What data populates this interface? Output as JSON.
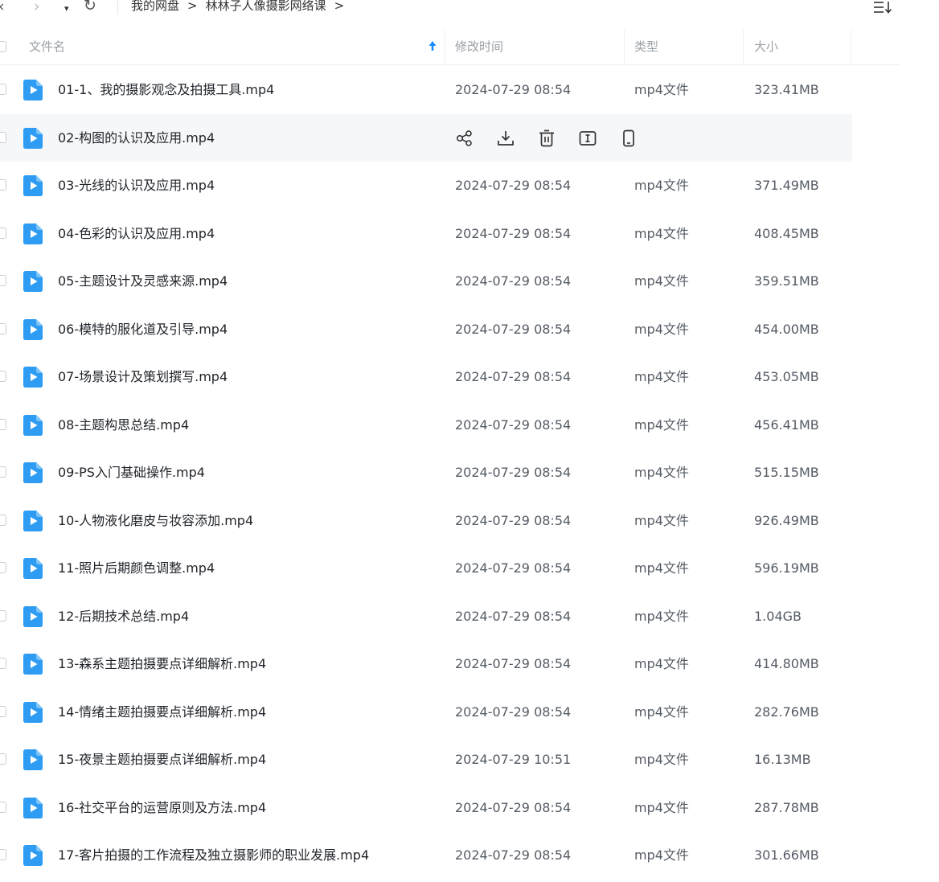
{
  "nav": {
    "back_glyph": "‹",
    "forward_glyph": "›",
    "history_glyph": "▾",
    "refresh_glyph": "↻"
  },
  "breadcrumb": {
    "items": [
      "我的网盘",
      "林林子人像摄影网络课"
    ],
    "separator": ">"
  },
  "header": {
    "name": "文件名",
    "time": "修改时间",
    "type": "类型",
    "size": "大小"
  },
  "icons": {
    "sort_menu": "sort-menu-icon",
    "sort_arrow": "arrow-up-icon",
    "file": "video-file-icon",
    "actions": [
      "share-icon",
      "download-icon",
      "delete-icon",
      "rename-icon",
      "mobile-icon"
    ]
  },
  "colors": {
    "accent": "#1a8cff",
    "file_icon": "#2d9cf2"
  },
  "files": [
    {
      "name": "01-1、我的摄影观念及拍摄工具.mp4",
      "time": "2024-07-29 08:54",
      "type": "mp4文件",
      "size": "323.41MB",
      "hover": false
    },
    {
      "name": "02-构图的认识及应用.mp4",
      "time": "",
      "type": "",
      "size": "",
      "hover": true
    },
    {
      "name": "03-光线的认识及应用.mp4",
      "time": "2024-07-29 08:54",
      "type": "mp4文件",
      "size": "371.49MB",
      "hover": false
    },
    {
      "name": "04-色彩的认识及应用.mp4",
      "time": "2024-07-29 08:54",
      "type": "mp4文件",
      "size": "408.45MB",
      "hover": false
    },
    {
      "name": "05-主题设计及灵感来源.mp4",
      "time": "2024-07-29 08:54",
      "type": "mp4文件",
      "size": "359.51MB",
      "hover": false
    },
    {
      "name": "06-模特的服化道及引导.mp4",
      "time": "2024-07-29 08:54",
      "type": "mp4文件",
      "size": "454.00MB",
      "hover": false
    },
    {
      "name": "07-场景设计及策划撰写.mp4",
      "time": "2024-07-29 08:54",
      "type": "mp4文件",
      "size": "453.05MB",
      "hover": false
    },
    {
      "name": "08-主题构思总结.mp4",
      "time": "2024-07-29 08:54",
      "type": "mp4文件",
      "size": "456.41MB",
      "hover": false
    },
    {
      "name": "09-PS入门基础操作.mp4",
      "time": "2024-07-29 08:54",
      "type": "mp4文件",
      "size": "515.15MB",
      "hover": false
    },
    {
      "name": "10-人物液化磨皮与妆容添加.mp4",
      "time": "2024-07-29 08:54",
      "type": "mp4文件",
      "size": "926.49MB",
      "hover": false
    },
    {
      "name": "11-照片后期颜色调整.mp4",
      "time": "2024-07-29 08:54",
      "type": "mp4文件",
      "size": "596.19MB",
      "hover": false
    },
    {
      "name": "12-后期技术总结.mp4",
      "time": "2024-07-29 08:54",
      "type": "mp4文件",
      "size": "1.04GB",
      "hover": false
    },
    {
      "name": "13-森系主题拍摄要点详细解析.mp4",
      "time": "2024-07-29 08:54",
      "type": "mp4文件",
      "size": "414.80MB",
      "hover": false
    },
    {
      "name": "14-情绪主题拍摄要点详细解析.mp4",
      "time": "2024-07-29 08:54",
      "type": "mp4文件",
      "size": "282.76MB",
      "hover": false
    },
    {
      "name": "15-夜景主题拍摄要点详细解析.mp4",
      "time": "2024-07-29 10:51",
      "type": "mp4文件",
      "size": "16.13MB",
      "hover": false
    },
    {
      "name": "16-社交平台的运营原则及方法.mp4",
      "time": "2024-07-29 08:54",
      "type": "mp4文件",
      "size": "287.78MB",
      "hover": false
    },
    {
      "name": "17-客片拍摄的工作流程及独立摄影师的职业发展.mp4",
      "time": "2024-07-29 08:54",
      "type": "mp4文件",
      "size": "301.66MB",
      "hover": false
    }
  ]
}
